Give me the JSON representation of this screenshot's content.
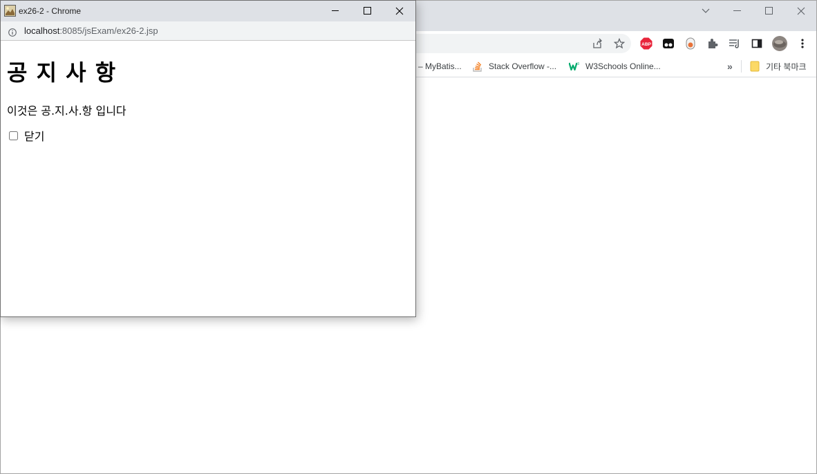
{
  "popup": {
    "title": "ex26-2 - Chrome",
    "url_host": "localhost",
    "url_path": ":8085/jsExam/ex26-2.jsp",
    "heading": "공 지 사 항",
    "message": "이것은 공.지.사.항 입니다",
    "close_checkbox_label": "닫기",
    "close_checkbox_checked": false
  },
  "bookmarks": [
    {
      "label": "– MyBatis...",
      "icon": "mybatis-icon"
    },
    {
      "label": "Stack Overflow -...",
      "icon": "stackoverflow-icon"
    },
    {
      "label": "W3Schools Online...",
      "icon": "w3schools-icon"
    }
  ],
  "bookmarks_more": "»",
  "other_bookmarks": "기타 북마크",
  "extensions": [
    "abp-icon",
    "tampermonkey-icon",
    "extension-icon",
    "puzzle-icon",
    "reading-list-icon",
    "side-panel-icon",
    "profile-avatar",
    "menu-icon"
  ],
  "abp_label": "ABP",
  "colors": {
    "titlebar": "#dee1e6",
    "urlbar": "#f1f3f4",
    "abp_red": "#e8253b",
    "w3_green": "#04aa6d",
    "stackoverflow_orange": "#f48024"
  }
}
